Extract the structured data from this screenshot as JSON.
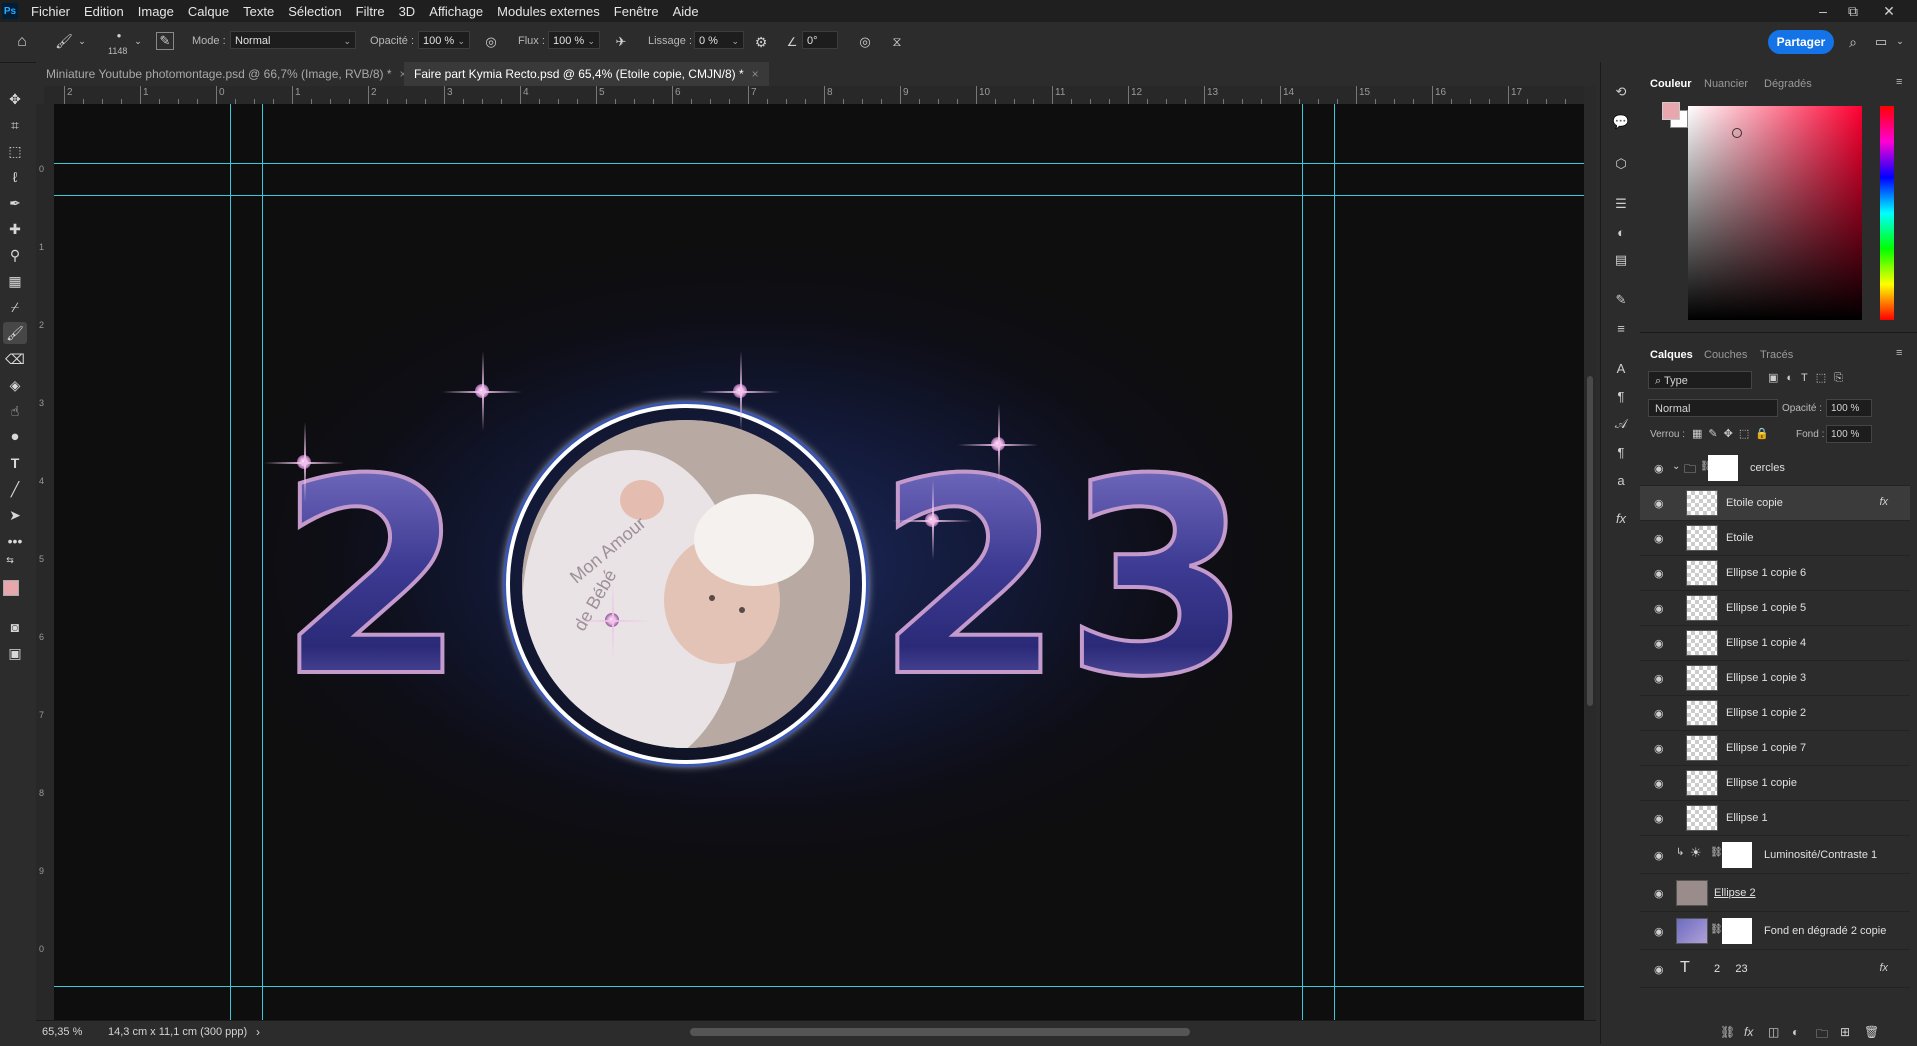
{
  "menubar": {
    "app_icon": "Ps",
    "items": [
      "Fichier",
      "Edition",
      "Image",
      "Calque",
      "Texte",
      "Sélection",
      "Filtre",
      "3D",
      "Affichage",
      "Modules externes",
      "Fenêtre",
      "Aide"
    ],
    "window_controls": [
      "–",
      "⧉",
      "✕"
    ]
  },
  "options": {
    "brush_size": "1148",
    "mode_label": "Mode :",
    "mode_value": "Normal",
    "opacity_label": "Opacité :",
    "opacity_value": "100 %",
    "flow_label": "Flux :",
    "flow_value": "100 %",
    "smoothing_label": "Lissage :",
    "smoothing_value": "0 %",
    "angle_value": "0°",
    "share_label": "Partager"
  },
  "tabs": [
    {
      "label": "Miniature Youtube photomontage.psd @ 66,7% (Image, RVB/8) *",
      "close": "×"
    },
    {
      "label": "Faire part Kymia Recto.psd @ 65,4% (Etoile  copie, CMJN/8) *",
      "close": "×"
    }
  ],
  "ruler_top": [
    "2",
    "1",
    "0",
    "1",
    "2",
    "3",
    "4",
    "5",
    "6",
    "7",
    "8",
    "9",
    "10",
    "11",
    "12",
    "13",
    "14",
    "15",
    "16",
    "17"
  ],
  "ruler_left": [
    "0",
    "1",
    "2",
    "3",
    "4",
    "5",
    "6",
    "7",
    "8",
    "9",
    "0"
  ],
  "canvas": {
    "year_left": "2",
    "year_right": "23",
    "photo_text_1": "Mon Amour",
    "photo_text_2": "de Bébé"
  },
  "status": {
    "zoom": "65,35 %",
    "doc_info": "14,3 cm x 11,1 cm (300 ppp)",
    "arrow": "›"
  },
  "color_panel": {
    "tabs": [
      "Couleur",
      "Nuancier",
      "Dégradés"
    ],
    "foreground": "#e8a6ad",
    "background": "#ffffff"
  },
  "layers_panel": {
    "tabs": [
      "Calques",
      "Couches",
      "Tracés"
    ],
    "filter_label": "Type",
    "blend_mode": "Normal",
    "opacity_label": "Opacité :",
    "opacity_value": "100 %",
    "lock_label": "Verrou :",
    "fill_label": "Fond :",
    "fill_value": "100 %",
    "layers": [
      {
        "name": "cercles",
        "kind": "group"
      },
      {
        "name": "Etoile  copie",
        "kind": "layer",
        "fx": "fx",
        "selected": true
      },
      {
        "name": "Etoile",
        "kind": "layer"
      },
      {
        "name": "Ellipse 1 copie 6",
        "kind": "layer"
      },
      {
        "name": "Ellipse 1 copie 5",
        "kind": "layer"
      },
      {
        "name": "Ellipse 1 copie 4",
        "kind": "layer"
      },
      {
        "name": "Ellipse 1 copie 3",
        "kind": "layer"
      },
      {
        "name": "Ellipse 1 copie 2",
        "kind": "layer"
      },
      {
        "name": "Ellipse 1 copie 7",
        "kind": "layer"
      },
      {
        "name": "Ellipse 1 copie",
        "kind": "layer"
      },
      {
        "name": "Ellipse 1",
        "kind": "layer"
      },
      {
        "name": "Luminosité/Contraste 1",
        "kind": "adjustment"
      },
      {
        "name": "Ellipse 2",
        "kind": "layer"
      },
      {
        "name": "Fond en dégradé 2 copie",
        "kind": "layer"
      },
      {
        "name": "2     23",
        "kind": "text",
        "fx": "fx"
      }
    ]
  }
}
